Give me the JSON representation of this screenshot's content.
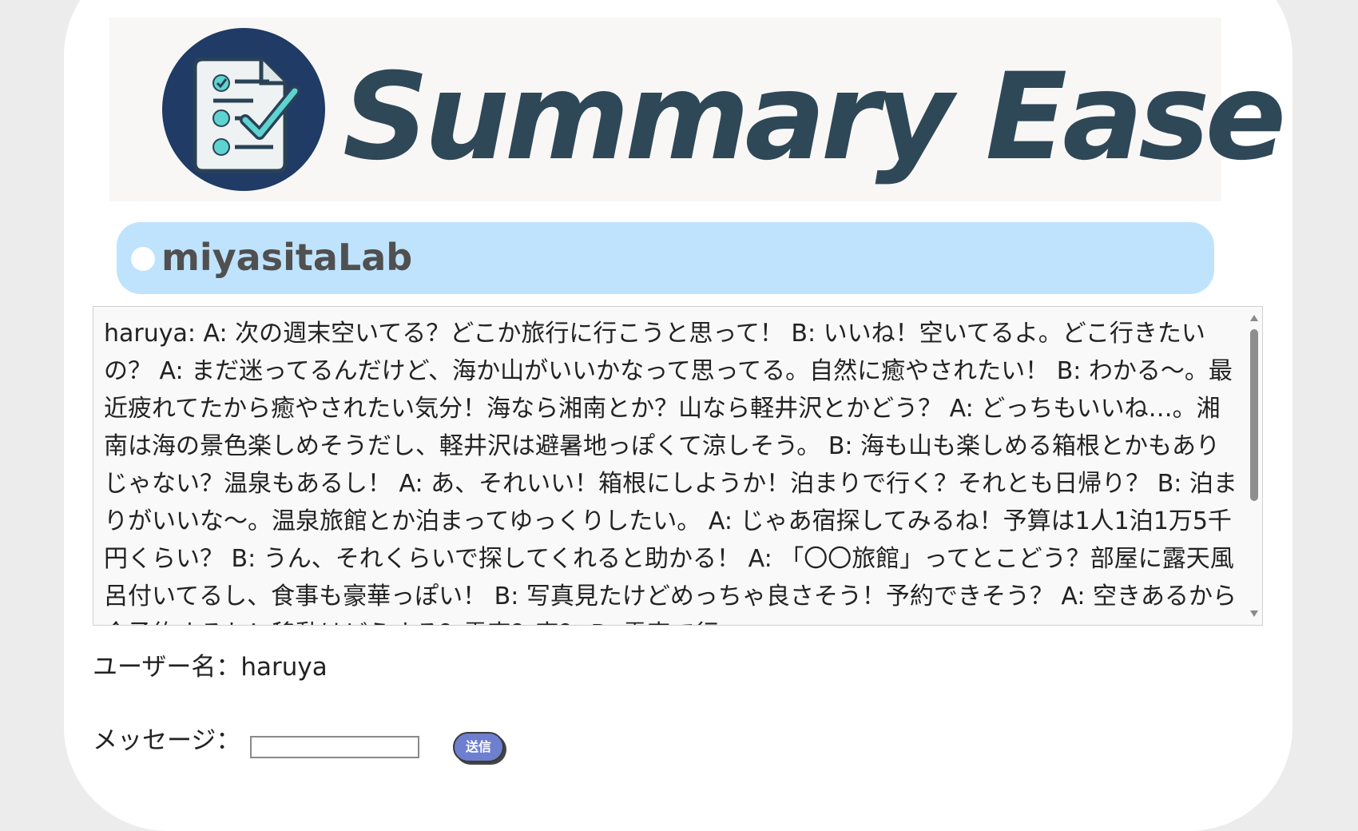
{
  "logo": {
    "title": "Summary Ease",
    "icon": "document-checklist-icon"
  },
  "lab": {
    "name": "miyasitaLab"
  },
  "chat": {
    "content": "haruya: A: 次の週末空いてる？どこか旅行に行こうと思って！ B: いいね！空いてるよ。どこ行きたいの？ A: まだ迷ってるんだけど、海か山がいいかなって思ってる。自然に癒やされたい！ B: わかる〜。最近疲れてたから癒やされたい気分！海なら湘南とか？山なら軽井沢とかどう？ A: どっちもいいね…。湘南は海の景色楽しめそうだし、軽井沢は避暑地っぽくて涼しそう。 B: 海も山も楽しめる箱根とかもありじゃない？温泉もあるし！ A: あ、それいい！箱根にしようか！泊まりで行く？それとも日帰り？ B: 泊まりがいいな〜。温泉旅館とか泊まってゆっくりしたい。 A: じゃあ宿探してみるね！予算は1人1泊1万5千円くらい？ B: うん、それくらいで探してくれると助かる！ A: 「〇〇旅館」ってとこどう？部屋に露天風呂付いてるし、食事も豪華っぽい！ B: 写真見たけどめっちゃ良さそう！予約できそう？ A: 空きあるから今予約するね！移動はどうする？電車？車？ B: 電車で行"
  },
  "user": {
    "label": "ユーザー名：haruya"
  },
  "message": {
    "label": "メッセージ：",
    "value": "",
    "placeholder": "",
    "send_label": "送信"
  },
  "colors": {
    "background": "#ececec",
    "card": "#ffffff",
    "lab_header": "#bfe3fd",
    "logo_text": "#2f4858",
    "send_button": "#6e7fd0"
  }
}
